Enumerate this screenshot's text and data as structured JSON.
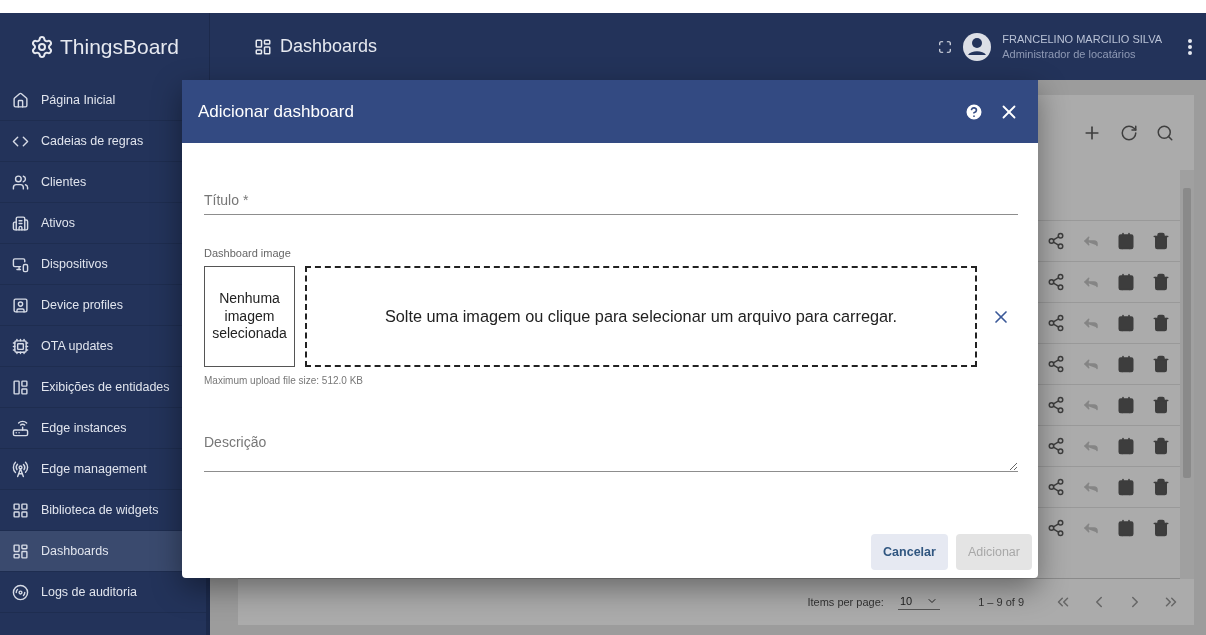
{
  "header": {
    "brand": "ThingsBoard",
    "section": "Dashboards",
    "user_name": "FRANCELINO MARCILIO SILVA",
    "user_role": "Administrador de locatários"
  },
  "sidebar": {
    "items": [
      {
        "label": "Página Inicial",
        "kind": "home",
        "selected": false
      },
      {
        "label": "Cadeias de regras",
        "kind": "code",
        "selected": false
      },
      {
        "label": "Clientes",
        "kind": "users",
        "selected": false
      },
      {
        "label": "Ativos",
        "kind": "building",
        "selected": false
      },
      {
        "label": "Dispositivos",
        "kind": "devices",
        "selected": false
      },
      {
        "label": "Device profiles",
        "kind": "profile",
        "selected": false
      },
      {
        "label": "OTA updates",
        "kind": "chip",
        "selected": false
      },
      {
        "label": "Exibições de entidades",
        "kind": "views",
        "selected": false
      },
      {
        "label": "Edge instances",
        "kind": "router",
        "selected": false
      },
      {
        "label": "Edge management",
        "kind": "tower",
        "selected": false
      },
      {
        "label": "Biblioteca de widgets",
        "kind": "widgets",
        "selected": false
      },
      {
        "label": "Dashboards",
        "kind": "dashboards",
        "selected": true
      },
      {
        "label": "Logs de auditoria",
        "kind": "audit",
        "selected": false
      }
    ]
  },
  "table": {
    "actions": [
      {
        "kind": "share",
        "disabled": false
      },
      {
        "kind": "reply",
        "disabled": true
      },
      {
        "kind": "badge",
        "disabled": false
      },
      {
        "kind": "delete",
        "disabled": false
      }
    ],
    "rows": [
      {
        "kind": "dashboard"
      },
      {
        "kind": "dashboard"
      },
      {
        "kind": "dashboard"
      },
      {
        "kind": "dashboard"
      },
      {
        "kind": "dashboard"
      },
      {
        "kind": "dashboard"
      },
      {
        "kind": "dashboard"
      },
      {
        "kind": "dashboard"
      }
    ],
    "pagination": {
      "items_label": "Items per page:",
      "page_size": "10",
      "range": "1 – 9 of 9"
    }
  },
  "dialog": {
    "title": "Adicionar dashboard",
    "title_field": {
      "placeholder": "Título *"
    },
    "image_label": "Dashboard image",
    "preview_text": "Nenhuma imagem selecionada",
    "dropzone_text": "Solte uma imagem ou clique para selecionar um arquivo para carregar.",
    "hint": "Maximum upload file size: 512.0 KB",
    "description_field": {
      "placeholder": "Descrição"
    },
    "buttons": [
      {
        "label": "Cancelar",
        "disabled": false
      },
      {
        "label": "Adicionar",
        "disabled": true
      }
    ]
  }
}
